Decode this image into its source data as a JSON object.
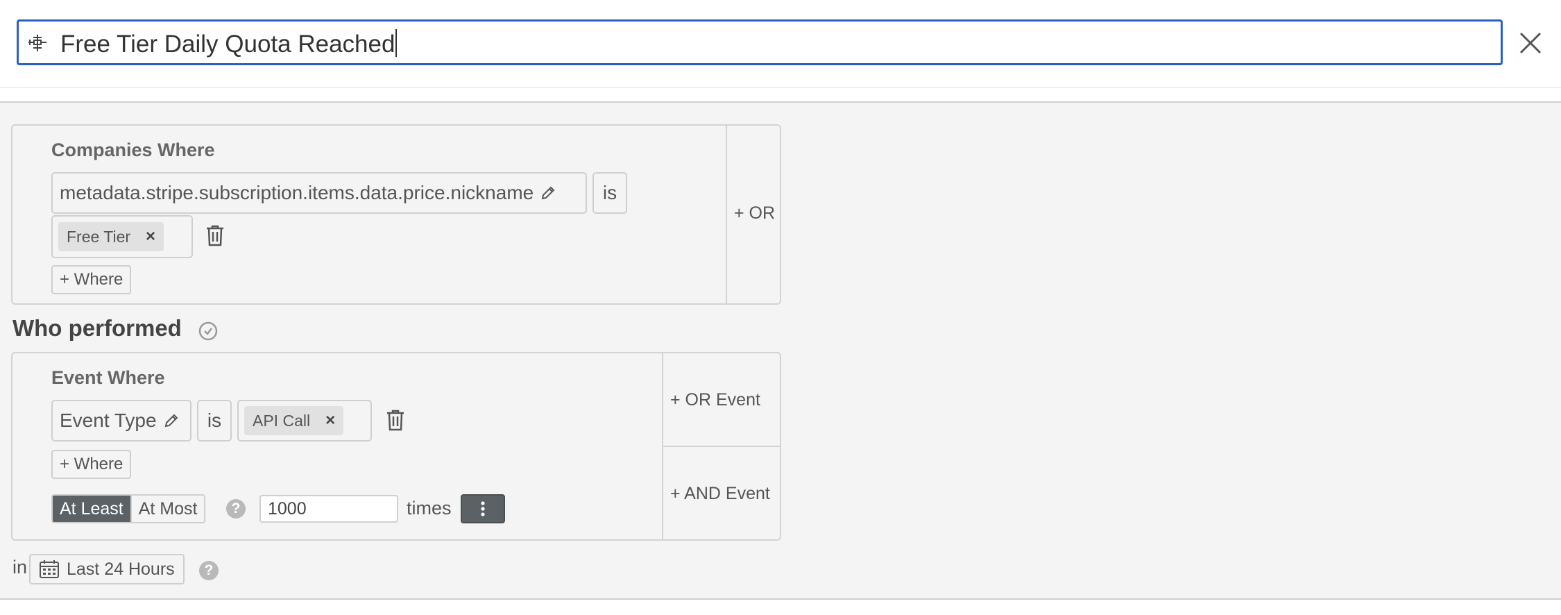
{
  "header": {
    "title_value": "Free Tier Daily Quota Reached",
    "title_icon": "segment-builder-icon",
    "close_icon": "close-icon"
  },
  "companies": {
    "label": "Companies Where",
    "field": "metadata.stripe.subscription.items.data.price.nickname",
    "operator": "is",
    "value_chip": "Free Tier",
    "add_where": "+ Where",
    "or_button": "+ OR"
  },
  "who_performed": {
    "heading": "Who performed",
    "icon": "clock-icon"
  },
  "event": {
    "label": "Event Where",
    "field": "Event Type",
    "operator": "is",
    "value_chip": "API Call",
    "add_where": "+ Where",
    "at_least": "At Least",
    "at_most": "At Most",
    "count": "1000",
    "times_label": "times",
    "or_event": "+ OR Event",
    "and_event": "+ AND Event"
  },
  "timeframe": {
    "prefix": "in",
    "range": "Last 24 Hours"
  },
  "colors": {
    "focus_border": "#2c5fc4",
    "panel_bg": "#f4f4f4",
    "active_segment": "#5b6164"
  }
}
